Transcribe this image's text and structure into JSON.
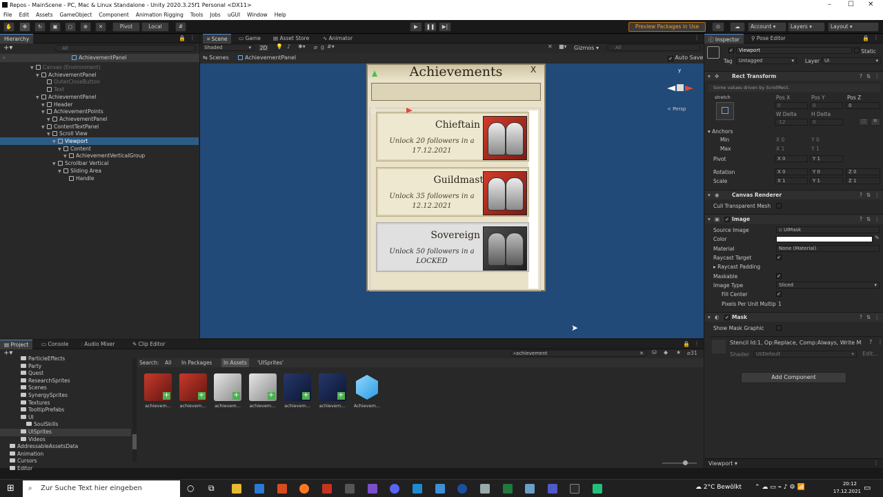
{
  "window": {
    "title": "Repos - MainScene - PC, Mac & Linux Standalone - Unity 2020.3.25f1 Personal <DX11>"
  },
  "menu": [
    "File",
    "Edit",
    "Assets",
    "GameObject",
    "Component",
    "Animation Rigging",
    "Tools",
    "Jobs",
    "uGUI",
    "Window",
    "Help"
  ],
  "toolbar": {
    "pivot": "Pivot",
    "local": "Local",
    "preview": "Preview Packages in Use",
    "account": "Account",
    "layers": "Layers",
    "layout": "Layout"
  },
  "hierarchy": {
    "tab": "Hierarchy",
    "search_placeholder": "All",
    "breadcrumb": "AchievementPanel",
    "rows": [
      {
        "label": "Canvas (Environment)",
        "dim": true
      },
      {
        "label": "AchievementPanel",
        "dim": false
      },
      {
        "label": "OuterCloseButton",
        "dim": true
      },
      {
        "label": "Text",
        "dim": true
      },
      {
        "label": "AchievementPanel",
        "dim": false
      },
      {
        "label": "Header",
        "dim": false
      },
      {
        "label": "AchievementPoints",
        "dim": false
      },
      {
        "label": "AchievementPanel",
        "dim": false
      },
      {
        "label": "ContentTextPanel",
        "dim": false
      },
      {
        "label": "Scroll View",
        "dim": false
      },
      {
        "label": "Viewport",
        "dim": false
      },
      {
        "label": "Content",
        "dim": false
      },
      {
        "label": "AchievementVerticalGroup",
        "dim": false
      },
      {
        "label": "Scrollbar Vertical",
        "dim": false
      },
      {
        "label": "Sliding Area",
        "dim": false
      },
      {
        "label": "Handle",
        "dim": false
      }
    ]
  },
  "scene": {
    "tabs": [
      "Scene",
      "Game",
      "Asset Store",
      "Animator"
    ],
    "shading": "Shaded",
    "mode": "2D",
    "gizmos": "Gizmos",
    "search_placeholder": "All",
    "breadcrumb_root": "Scenes",
    "breadcrumb_leaf": "AchievementPanel",
    "autosave": "Auto Save",
    "persp": "< Persp",
    "counter": "0"
  },
  "achievements": {
    "title": "Achievements",
    "close": "X",
    "cards": [
      {
        "name": "Chieftain",
        "desc": "Unlock 20 followers in a",
        "date": "17.12.2021",
        "locked": false
      },
      {
        "name": "Guildmaster",
        "desc": "Unlock 35 followers in a",
        "date": "12.12.2021",
        "locked": false
      },
      {
        "name": "Sovereign",
        "desc": "Unlock 50 followers in a",
        "date": "LOCKED",
        "locked": true
      }
    ]
  },
  "inspector": {
    "tabs": [
      "Inspector",
      "Pose Editor"
    ],
    "object_name": "Viewport",
    "static": "Static",
    "tag_label": "Tag",
    "tag": "Untagged",
    "layer_label": "Layer",
    "layer": "UI",
    "rect_transform": {
      "title": "Rect Transform",
      "note": "Some values driven by ScrollRect.",
      "stretch": "stretch",
      "posx_label": "Pos X",
      "posy_label": "Pos Y",
      "posz_label": "Pos Z",
      "posx": "0",
      "posy": "0",
      "posz": "0",
      "wdelta_label": "W Delta",
      "hdelta_label": "H Delta",
      "wdelta": "-12",
      "hdelta": "0",
      "anchors": "Anchors",
      "min": "Min",
      "max": "Max",
      "min_x": "0",
      "min_y": "0",
      "max_x": "1",
      "max_y": "1",
      "pivot": "Pivot",
      "pivot_x": "0",
      "pivot_y": "1",
      "rotation": "Rotation",
      "rot_x": "0",
      "rot_y": "0",
      "rot_z": "0",
      "scale": "Scale",
      "scale_x": "1",
      "scale_y": "1",
      "scale_z": "1"
    },
    "canvas_renderer": {
      "title": "Canvas Renderer",
      "cull": "Cull Transparent Mesh"
    },
    "image": {
      "title": "Image",
      "source_label": "Source Image",
      "source": "UIMask",
      "color_label": "Color",
      "material_label": "Material",
      "material": "None (Material)",
      "raycast_target": "Raycast Target",
      "raycast_padding": "Raycast Padding",
      "maskable": "Maskable",
      "image_type_label": "Image Type",
      "image_type": "Sliced",
      "fill_center": "Fill Center",
      "ppu": "Pixels Per Unit Multip",
      "ppu_value": "1"
    },
    "mask": {
      "title": "Mask",
      "show_graphic": "Show Mask Graphic",
      "stencil": "Stencil Id:1, Op:Replace, Comp:Always, Write M",
      "shader_label": "Shader",
      "shader": "UI/Default",
      "edit": "Edit..."
    },
    "add_component": "Add Component",
    "footer": "Viewport"
  },
  "project": {
    "tabs": [
      "Project",
      "Console",
      "Audio Mixer",
      "Clip Editor"
    ],
    "search_value": "achievement",
    "search_label": "Search:",
    "filters": [
      "All",
      "In Packages",
      "In Assets",
      "'UISprites'"
    ],
    "count": "31",
    "folders": [
      {
        "label": "ParticleEffects",
        "indent": 1
      },
      {
        "label": "Party",
        "indent": 1
      },
      {
        "label": "Quest",
        "indent": 1
      },
      {
        "label": "ResearchSprites",
        "indent": 1
      },
      {
        "label": "Scenes",
        "indent": 1
      },
      {
        "label": "SynergySprites",
        "indent": 1
      },
      {
        "label": "Textures",
        "indent": 1
      },
      {
        "label": "TooltipPrefabs",
        "indent": 1
      },
      {
        "label": "UI",
        "indent": 1
      },
      {
        "label": "SoulSkills",
        "indent": 2
      },
      {
        "label": "UISprites",
        "indent": 1
      },
      {
        "label": "Videos",
        "indent": 1
      },
      {
        "label": "AddressableAssetsData",
        "indent": 0
      },
      {
        "label": "Animation",
        "indent": 0
      },
      {
        "label": "Cursors",
        "indent": 0
      },
      {
        "label": "Editor",
        "indent": 0
      }
    ],
    "assets": [
      {
        "label": "achievem...",
        "kind": "red"
      },
      {
        "label": "achievem...",
        "kind": "red"
      },
      {
        "label": "achievem...",
        "kind": "grey"
      },
      {
        "label": "achievem...",
        "kind": "grey"
      },
      {
        "label": "achievem...",
        "kind": "blue"
      },
      {
        "label": "achievem...",
        "kind": "blue"
      },
      {
        "label": "Achievem...",
        "kind": "cube"
      }
    ]
  },
  "taskbar": {
    "search_placeholder": "Zur Suche Text hier eingeben",
    "weather": "2°C Bewölkt",
    "time": "20:12",
    "date": "17.12.2021"
  }
}
